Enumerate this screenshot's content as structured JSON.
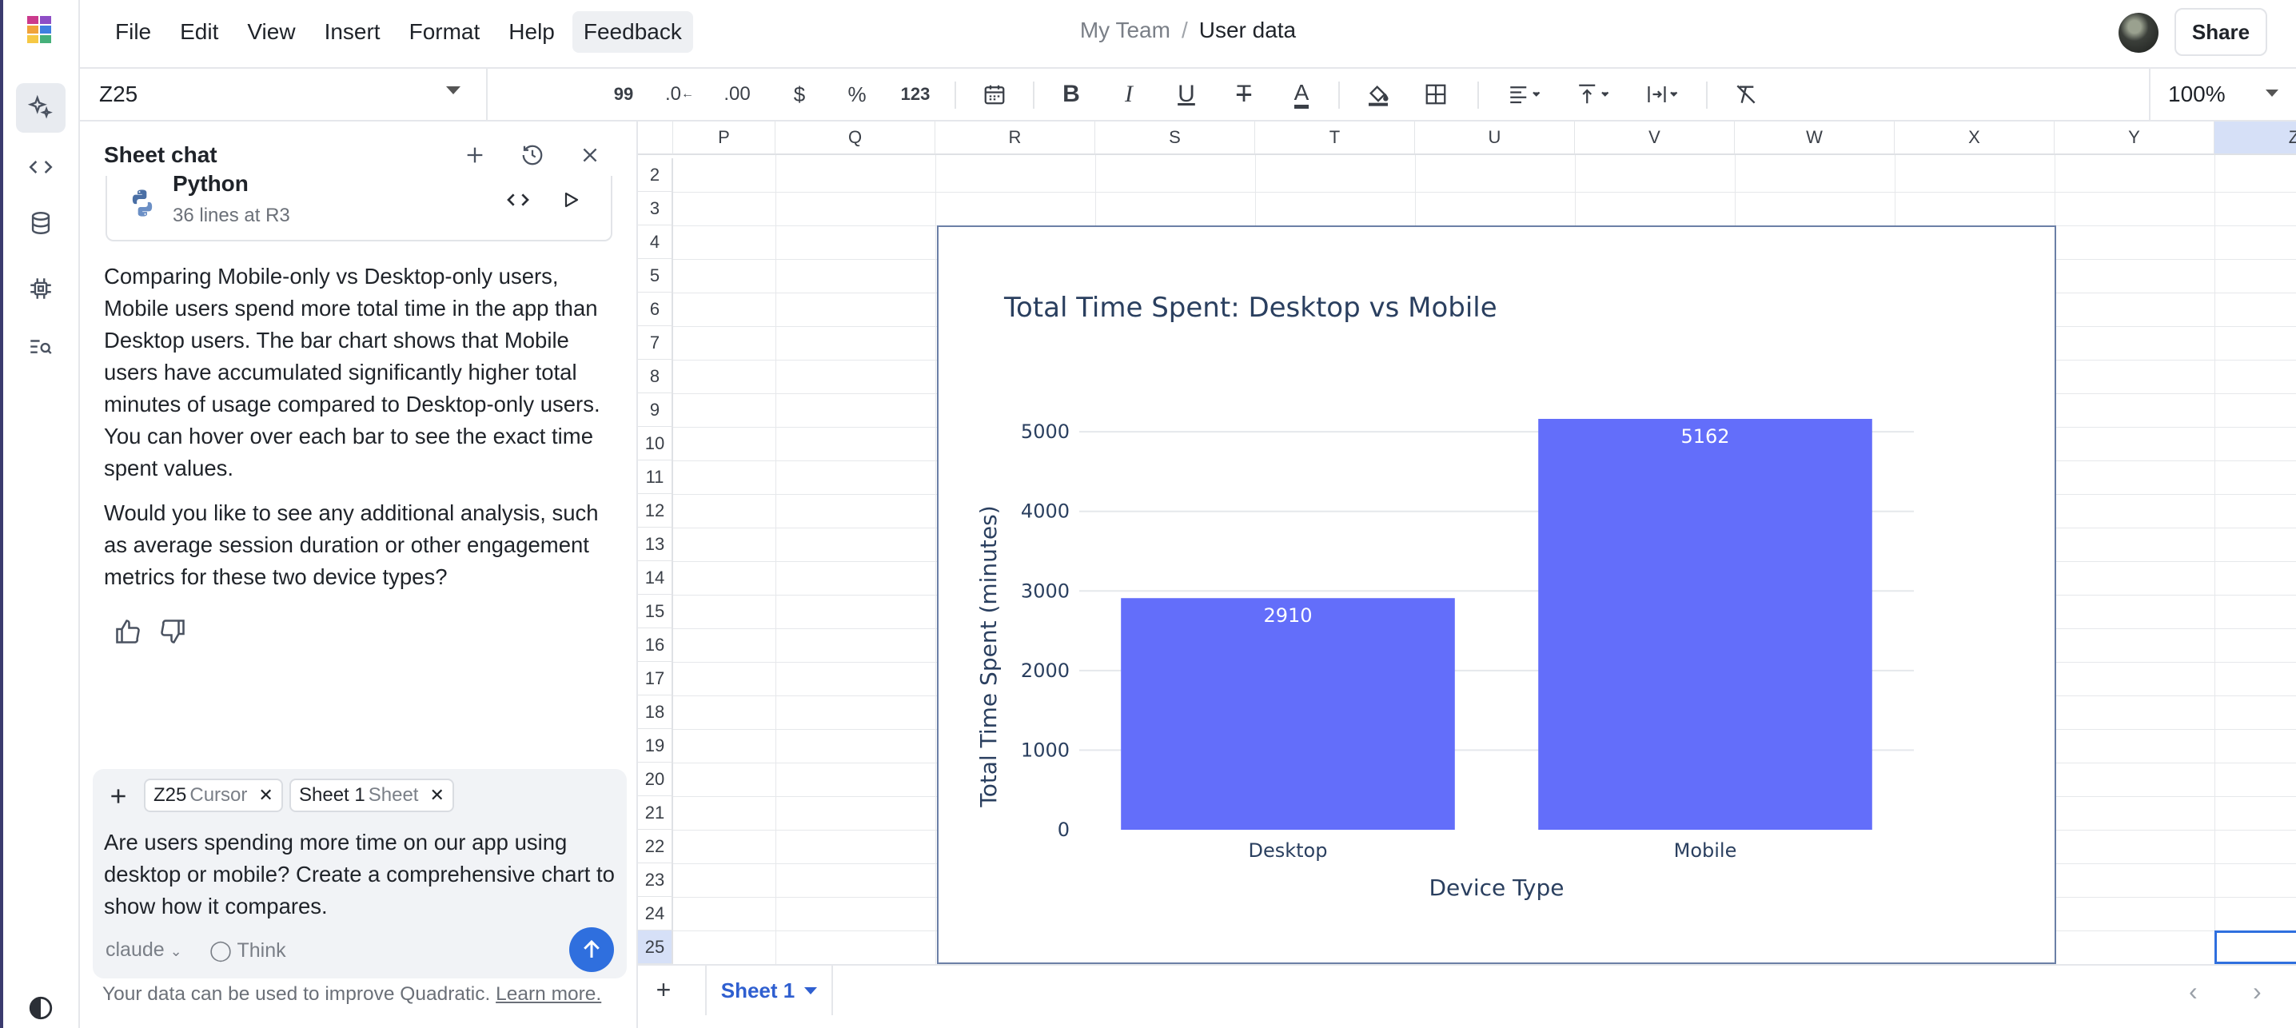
{
  "menubar": {
    "items": [
      "File",
      "Edit",
      "View",
      "Insert",
      "Format",
      "Help",
      "Feedback"
    ],
    "team": "My Team",
    "separator": "/",
    "file_name": "User data",
    "share_label": "Share"
  },
  "rail": {
    "items": [
      "ai-assistant",
      "code",
      "connections",
      "model-context",
      "search-cells",
      "theme-toggle"
    ]
  },
  "toolbar": {
    "name_box": "Z25",
    "number_format_labels": [
      "99",
      ".0",
      ".00",
      "$",
      "%",
      "123"
    ],
    "zoom": "100%"
  },
  "chat": {
    "title": "Sheet chat",
    "code_card": {
      "title": "Python",
      "subtitle": "36 lines at R3"
    },
    "response_1": "Comparing Mobile-only vs Desktop-only users, Mobile users spend more total time in the app than Desktop users. The bar chart shows that Mobile users have accumulated significantly higher total minutes of usage compared to Desktop-only users. You can hover over each bar to see the exact time spent values.",
    "response_2": "Would you like to see any additional analysis, such as average session duration or other engagement metrics for these two device types?",
    "context_chips": [
      {
        "label": "Z25",
        "kind": "Cursor"
      },
      {
        "label": "Sheet 1",
        "kind": "Sheet"
      }
    ],
    "prompt": "Are users spending more time on our app using desktop or mobile? Create a comprehensive chart to show how it compares.",
    "model": "claude",
    "think_label": "Think",
    "disclaimer": "Your data can be used to improve Quadratic.",
    "learn_more": "Learn more."
  },
  "grid": {
    "columns": [
      "P",
      "Q",
      "R",
      "S",
      "T",
      "U",
      "V",
      "W",
      "X",
      "Y",
      "Z"
    ],
    "selected_column": "Z",
    "rows": [
      "2",
      "3",
      "4",
      "5",
      "6",
      "7",
      "8",
      "9",
      "10",
      "11",
      "12",
      "13",
      "14",
      "15",
      "16",
      "17",
      "18",
      "19",
      "20",
      "21",
      "22",
      "23",
      "24",
      "25"
    ],
    "selected_row": "25"
  },
  "chart_data": {
    "type": "bar",
    "title": "Total Time Spent: Desktop vs Mobile",
    "xlabel": "Device Type",
    "ylabel": "Total Time Spent (minutes)",
    "categories": [
      "Desktop",
      "Mobile"
    ],
    "values": [
      2910,
      5162
    ],
    "data_labels": [
      "2910",
      "5162"
    ],
    "ylim": [
      0,
      5162
    ],
    "yticks": [
      0,
      1000,
      2000,
      3000,
      4000,
      5000
    ],
    "grid": true,
    "legend": "none",
    "bar_color": "#636efa",
    "label_color": "#ffffff",
    "text_color": "#2a3f5f"
  },
  "bottombar": {
    "sheet_tab": "Sheet 1"
  },
  "colors": {
    "accent": "#2f6fde",
    "selection": "#d6e0f7"
  }
}
